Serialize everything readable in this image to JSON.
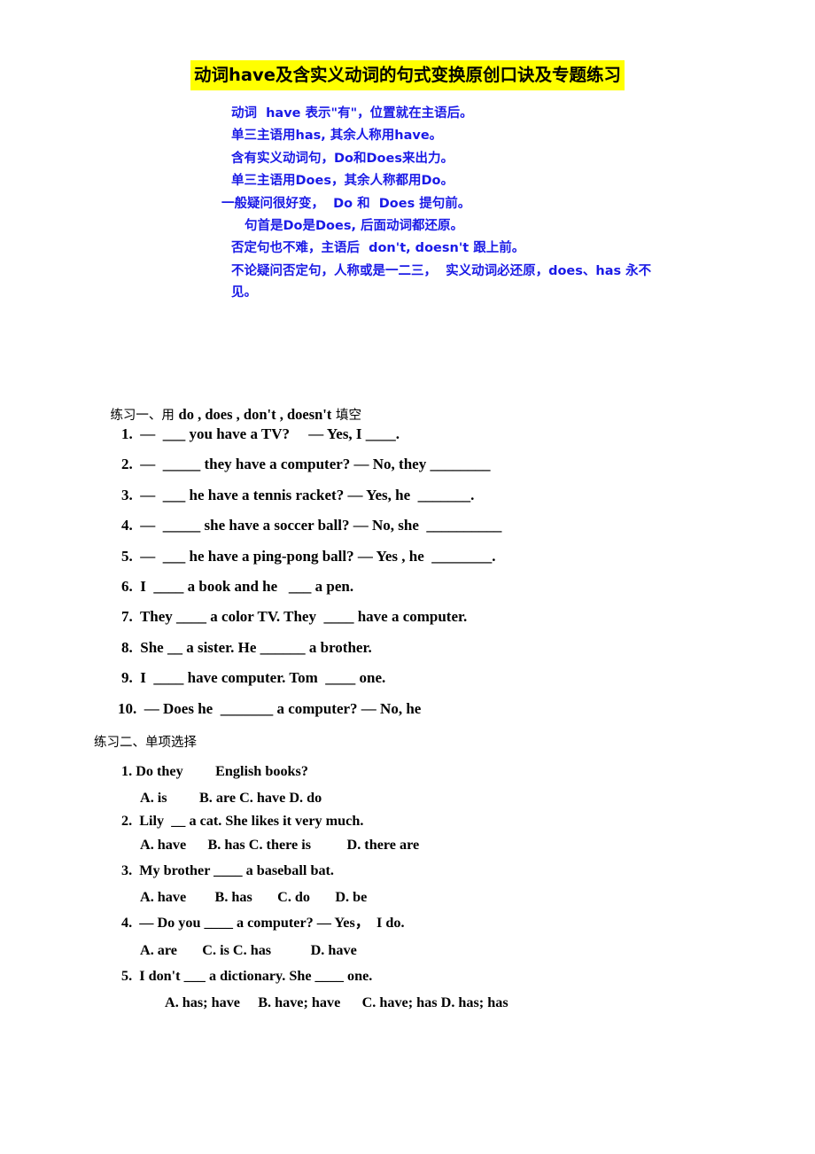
{
  "document": {
    "title": "动词have及含实义动词的句式变换原创口诀及专题练习",
    "title_highlight_color": "#FFFF00",
    "rhyme_color": "#1A1AE6"
  },
  "rhyme": {
    "lines": [
      "动词  have 表示\"有\"，位置就在主语后。",
      "单三主语用has, 其余人称用have。",
      "含有实义动词句，Do和Does来出力。",
      "单三主语用Does，其余人称都用Do。",
      "一般疑问很好变，  Do 和  Does 提句前。",
      "句首是Do是Does, 后面动词都还原。",
      "否定句也不难，主语后  don't, doesn't 跟上前。",
      "不论疑问否定句，人称或是一二三，  实义动词必还原，does、has 永不见。"
    ]
  },
  "exercise_one": {
    "heading_cn": "练习一、用 ",
    "heading_en": "do , does , don't , doesn't",
    "heading_cn_tail": " 填空",
    "questions": [
      "1.  —  ___ you have a TV?     — Yes, I ____.",
      "2.  —  _____ they have a computer? — No, they ________",
      "3.  —  ___ he have a tennis racket? — Yes, he  _______.",
      "4.  —  _____ she have a soccer ball? — No, she  __________",
      "5.  —  ___ he have a ping-pong ball? — Yes , he  ________.",
      "6.  I  ____ a book and he   ___ a pen.",
      "7.  They ____ a color TV. They  ____ have a computer.",
      "8.  She __ a sister. He ______ a brother.",
      "9.  I  ____ have computer. Tom  ____ one.",
      "10.  — Does he  _______ a computer? — No, he"
    ]
  },
  "exercise_two": {
    "heading": "练习二、单项选择",
    "items": [
      {
        "question": "1. Do they         English books?",
        "options": "A. is         B. are C. have D. do"
      },
      {
        "question": "2.  Lily  __ a cat. She likes it very much.",
        "options": "A. have      B. has C. there is          D. there are"
      },
      {
        "question": "3.  My brother ____ a baseball bat.",
        "options": "A. have        B. has       C. do       D. be"
      },
      {
        "question": "4.  — Do you ____ a computer? — Yes，  I do.",
        "options": "A. are       C. is C. has           D. have"
      },
      {
        "question": "5.  I don't ___ a dictionary. She ____ one.",
        "options": "A. has; have     B. have; have      C. have; has D. has; has"
      }
    ]
  }
}
